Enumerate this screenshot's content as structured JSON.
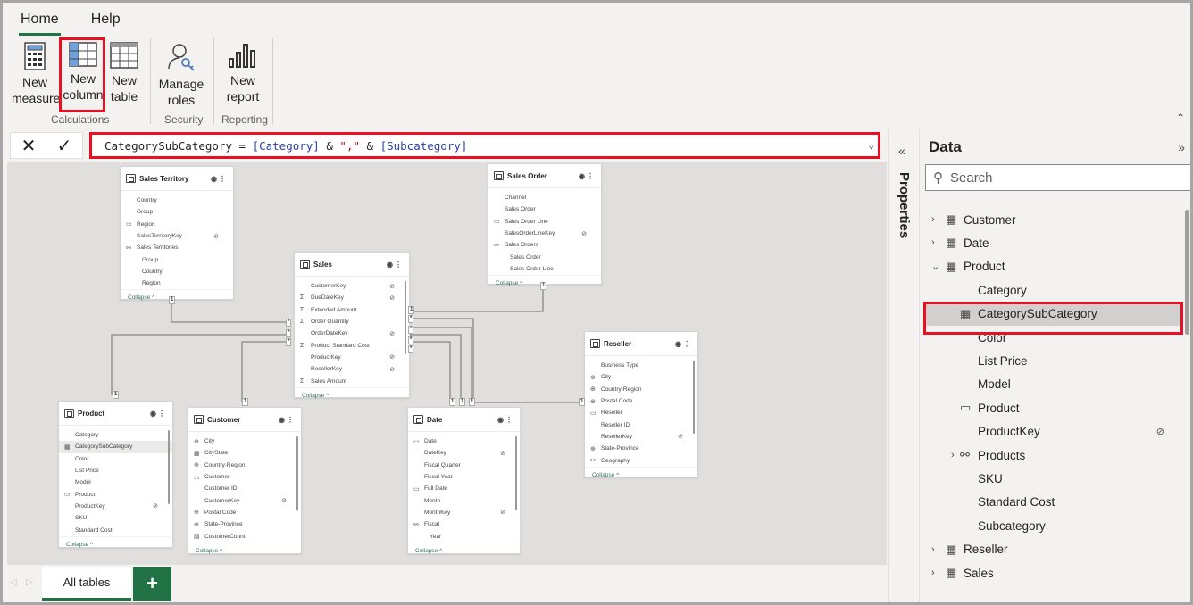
{
  "tabs": [
    {
      "label": "Home",
      "active": true
    },
    {
      "label": "Help",
      "active": false
    }
  ],
  "ribbon": {
    "new_measure": "New\nmeasure",
    "new_column": "New\ncolumn",
    "new_table": "New\ntable",
    "manage_roles": "Manage\nroles",
    "new_report": "New\nreport",
    "groups": {
      "calculations": "Calculations",
      "security": "Security",
      "reporting": "Reporting"
    }
  },
  "formula": {
    "name": "CategorySubCategory",
    "op": " = ",
    "ref1": "[Category]",
    "amp1": " & ",
    "str": "\",\"",
    "amp2": " & ",
    "ref2": "[Subcategory]"
  },
  "tables": [
    {
      "id": "t-st",
      "name": "Sales Territory",
      "scroll": false,
      "fields": [
        {
          "label": "Country"
        },
        {
          "label": "Group"
        },
        {
          "label": "Region",
          "icon": "id-card"
        },
        {
          "label": "SalesTerritoryKey",
          "hidden": true
        },
        {
          "label": "Sales Territories",
          "icon": "hierarchy"
        },
        {
          "label": "Group",
          "sub": true
        },
        {
          "label": "Country",
          "sub": true
        },
        {
          "label": "Region",
          "sub": true
        }
      ]
    },
    {
      "id": "t-sales",
      "name": "Sales",
      "scroll": true,
      "fields": [
        {
          "label": "CustomerKey",
          "hidden": true
        },
        {
          "label": "DueDateKey",
          "icon": "sigma",
          "hidden": true
        },
        {
          "label": "Extended Amount",
          "icon": "sigma"
        },
        {
          "label": "Order Quantity",
          "icon": "sigma"
        },
        {
          "label": "OrderDateKey",
          "hidden": true
        },
        {
          "label": "Product Standard Cost",
          "icon": "sigma"
        },
        {
          "label": "ProductKey",
          "hidden": true
        },
        {
          "label": "ResellerKey",
          "hidden": true
        },
        {
          "label": "Sales Amount",
          "icon": "sigma"
        }
      ]
    },
    {
      "id": "t-so",
      "name": "Sales Order",
      "scroll": false,
      "fields": [
        {
          "label": "Channel"
        },
        {
          "label": "Sales Order"
        },
        {
          "label": "Sales Order Line",
          "icon": "id-card"
        },
        {
          "label": "SalesOrderLineKey",
          "hidden": true
        },
        {
          "label": "Sales Orders",
          "icon": "hierarchy"
        },
        {
          "label": "Sales Order",
          "sub": true
        },
        {
          "label": "Sales Order Line",
          "sub": true
        }
      ]
    },
    {
      "id": "t-res",
      "name": "Reseller",
      "scroll": true,
      "fields": [
        {
          "label": "Business Type"
        },
        {
          "label": "City",
          "icon": "globe"
        },
        {
          "label": "Country-Region",
          "icon": "globe"
        },
        {
          "label": "Postal Code",
          "icon": "globe"
        },
        {
          "label": "Reseller",
          "icon": "id-card"
        },
        {
          "label": "Reseller ID"
        },
        {
          "label": "ResellerKey",
          "hidden": true
        },
        {
          "label": "State-Province",
          "icon": "globe"
        },
        {
          "label": "Geography",
          "icon": "hierarchy"
        }
      ]
    },
    {
      "id": "t-prod",
      "name": "Product",
      "scroll": true,
      "fields": [
        {
          "label": "Category"
        },
        {
          "label": "CategorySubCategory",
          "icon": "calc-column",
          "selected": true
        },
        {
          "label": "Color"
        },
        {
          "label": "List Price"
        },
        {
          "label": "Model"
        },
        {
          "label": "Product",
          "icon": "id-card"
        },
        {
          "label": "ProductKey",
          "hidden": true
        },
        {
          "label": "SKU"
        },
        {
          "label": "Standard Cost"
        }
      ]
    },
    {
      "id": "t-cust",
      "name": "Customer",
      "scroll": true,
      "fields": [
        {
          "label": "City",
          "icon": "globe"
        },
        {
          "label": "CityState",
          "icon": "calc-column"
        },
        {
          "label": "Country-Region",
          "icon": "globe"
        },
        {
          "label": "Customer",
          "icon": "id-card"
        },
        {
          "label": "Customer ID"
        },
        {
          "label": "CustomerKey",
          "hidden": true
        },
        {
          "label": "Postal Code",
          "icon": "globe"
        },
        {
          "label": "State-Province",
          "icon": "globe"
        },
        {
          "label": "CustomerCount",
          "icon": "measure"
        }
      ]
    },
    {
      "id": "t-date",
      "name": "Date",
      "scroll": true,
      "fields": [
        {
          "label": "Date",
          "icon": "id-card"
        },
        {
          "label": "DateKey",
          "hidden": true
        },
        {
          "label": "Fiscal Quarter"
        },
        {
          "label": "Fiscal Year"
        },
        {
          "label": "Full Date",
          "icon": "id-card"
        },
        {
          "label": "Month"
        },
        {
          "label": "MonthKey",
          "hidden": true
        },
        {
          "label": "Fiscal",
          "icon": "hierarchy"
        },
        {
          "label": "Year",
          "sub": true
        }
      ]
    }
  ],
  "collapse_label": "Collapse ^",
  "bottom": {
    "all_tables": "All tables",
    "add": "+"
  },
  "properties_label": "Properties",
  "data_pane": {
    "title": "Data",
    "search_placeholder": "Search",
    "items": [
      {
        "label": "Customer",
        "level": 0,
        "chev": ">",
        "icon": "table"
      },
      {
        "label": "Date",
        "level": 0,
        "chev": ">",
        "icon": "table"
      },
      {
        "label": "Product",
        "level": 0,
        "chev": "v",
        "icon": "table"
      },
      {
        "label": "Category",
        "level": 1
      },
      {
        "label": "CategorySubCategory",
        "level": 1,
        "icon": "calc-column",
        "selected": true
      },
      {
        "label": "Color",
        "level": 1
      },
      {
        "label": "List Price",
        "level": 1
      },
      {
        "label": "Model",
        "level": 1
      },
      {
        "label": "Product",
        "level": 1,
        "icon": "id-card"
      },
      {
        "label": "ProductKey",
        "level": 1,
        "hidden": true
      },
      {
        "label": "Products",
        "level": 1,
        "chev": ">",
        "icon": "hierarchy"
      },
      {
        "label": "SKU",
        "level": 1
      },
      {
        "label": "Standard Cost",
        "level": 1
      },
      {
        "label": "Subcategory",
        "level": 1
      },
      {
        "label": "Reseller",
        "level": 0,
        "chev": ">",
        "icon": "table"
      },
      {
        "label": "Sales",
        "level": 0,
        "chev": ">",
        "icon": "table"
      }
    ]
  },
  "colors": {
    "accent": "#217346",
    "highlight": "#e81123"
  }
}
